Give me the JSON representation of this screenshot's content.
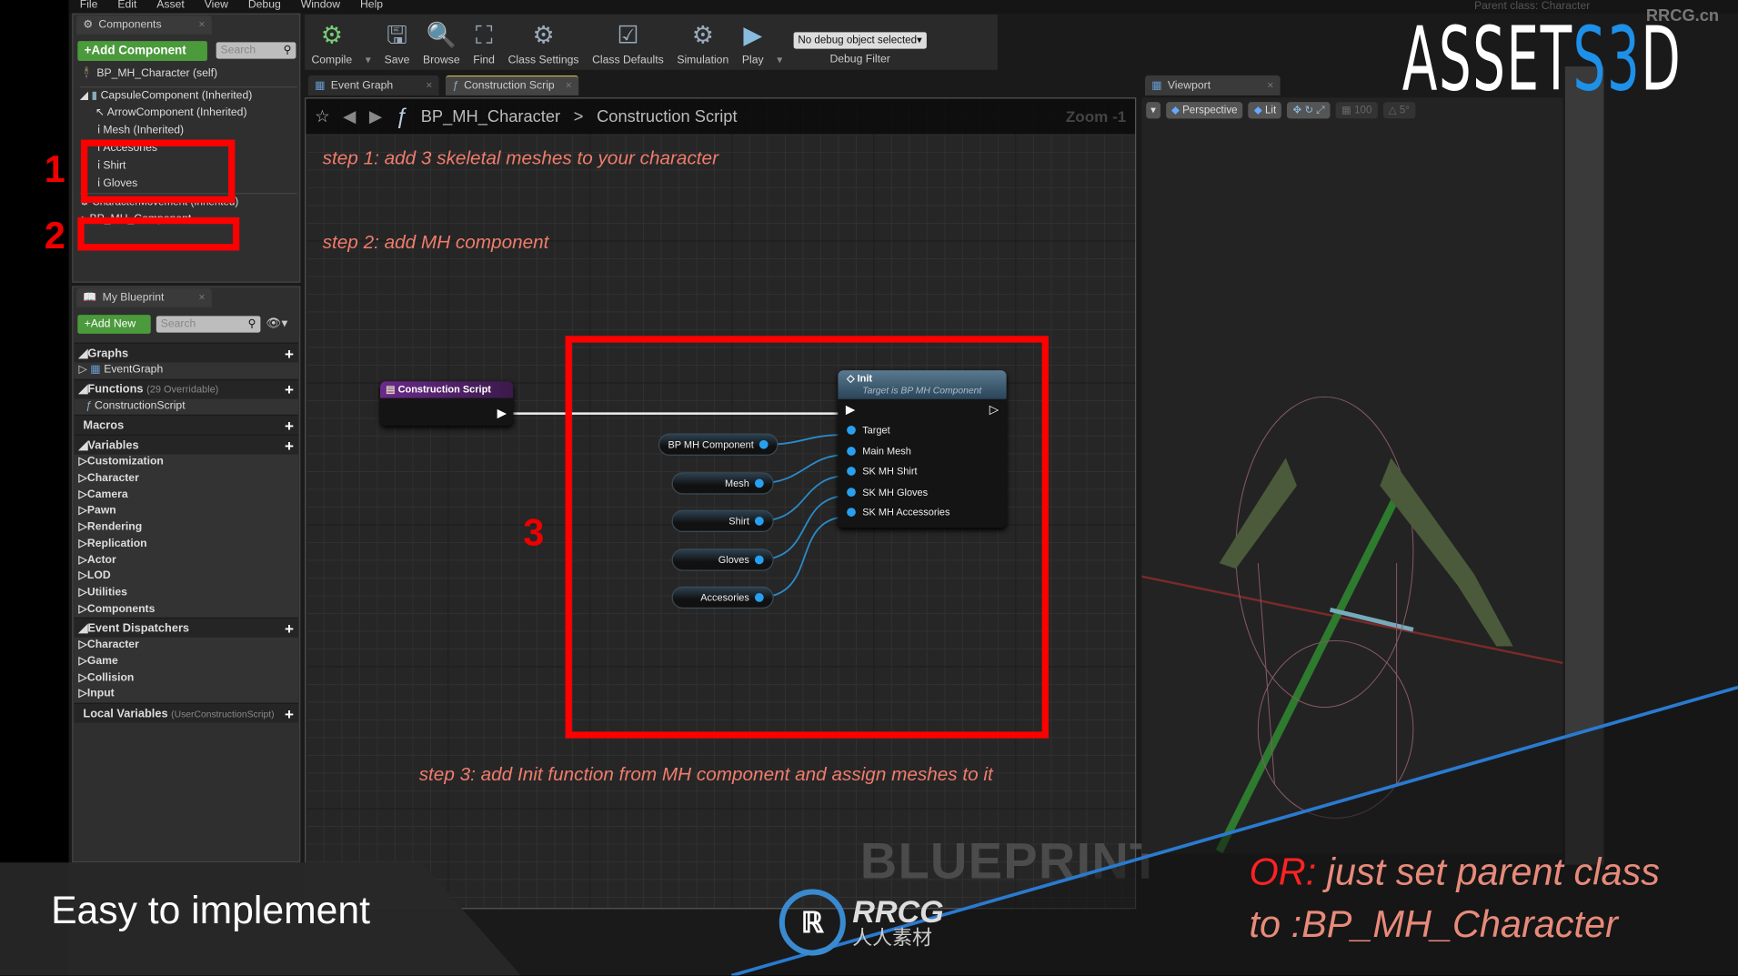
{
  "menu": [
    "File",
    "Edit",
    "Asset",
    "View",
    "Debug",
    "Window",
    "Help"
  ],
  "components": {
    "tab": "Components",
    "add_button": "+Add Component",
    "search_placeholder": "Search",
    "tree": [
      "BP_MH_Character (self)",
      "CapsuleComponent (Inherited)",
      "ArrowComponent (Inherited)",
      "Mesh (Inherited)",
      "Accesories",
      "Shirt",
      "Gloves",
      "CharacterMovement (Inherited)",
      "BP_MH_Component"
    ]
  },
  "markers": {
    "one": "1",
    "two": "2",
    "three": "3"
  },
  "my_blueprint": {
    "tab": "My Blueprint",
    "add_button": "+Add New",
    "search_placeholder": "Search",
    "graphs": "Graphs",
    "event_graph": "EventGraph",
    "functions": "Functions",
    "functions_note": "(29 Overridable)",
    "construction_script": "ConstructionScript",
    "macros": "Macros",
    "variables": "Variables",
    "variable_cats": [
      "Customization",
      "Character",
      "Camera",
      "Pawn",
      "Rendering",
      "Replication",
      "Actor",
      "LOD",
      "Utilities",
      "Components"
    ],
    "event_dispatchers": "Event Dispatchers",
    "dispatcher_cats": [
      "Character",
      "Game",
      "Collision",
      "Input"
    ],
    "local_variables": "Local Variables",
    "local_note": "(UserConstructionScript)"
  },
  "toolbar": [
    "Compile",
    "Save",
    "Browse",
    "Find",
    "Class Settings",
    "Class Defaults",
    "Simulation",
    "Play"
  ],
  "debug": {
    "selected": "No debug object selected",
    "label": "Debug Filter"
  },
  "parent_class": "Parent class:  Character",
  "tabs": [
    "Event Graph",
    "Construction Scrip"
  ],
  "breadcrumb": {
    "class": "BP_MH_Character",
    "sep": ">",
    "graph": "Construction Script",
    "zoom": "Zoom -1"
  },
  "steps": [
    "step 1: add 3 skeletal meshes to your character",
    "step 2: add MH component",
    "step 3: add Init function from MH component and assign meshes to it"
  ],
  "nodes": {
    "event": "Construction Script",
    "init_title": "Init",
    "init_sub": "Target is BP MH Component",
    "init_pins": [
      "Target",
      "Main Mesh",
      "SK MH Shirt",
      "SK MH Gloves",
      "SK MH Accessories"
    ],
    "vars": [
      "BP MH Component",
      "Mesh",
      "Shirt",
      "Gloves",
      "Accesories"
    ]
  },
  "viewport": {
    "tab": "Viewport",
    "perspective": "Perspective",
    "lit": "Lit",
    "grid": "100",
    "angle": "5°"
  },
  "overlay": {
    "watermark": "BLUEPRINT",
    "logo": "ASSETS3D",
    "site": "RRCG.cn",
    "rrcg": "RRCG",
    "rrcg_cn": "人人素材",
    "headline": "Easy to implement",
    "or_label": "OR:",
    "or_line1": " just set parent class",
    "or_line2": "to :BP_MH_Character"
  },
  "colors": {
    "accent_red": "#ff0000",
    "step_text": "#f07c6c",
    "pin_blue": "#28a0f0",
    "logo_blue": "#1e90e8"
  }
}
